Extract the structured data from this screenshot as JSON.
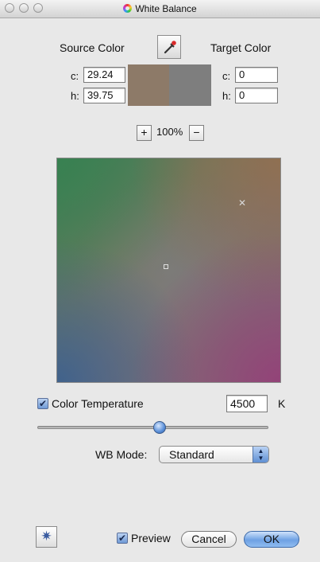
{
  "window": {
    "title": "White Balance"
  },
  "source": {
    "label": "Source Color",
    "c_label": "c:",
    "c_value": "29.24",
    "h_label": "h:",
    "h_value": "39.75",
    "swatch_color": "#8d7a68"
  },
  "target": {
    "label": "Target Color",
    "c_label": "c:",
    "c_value": "0",
    "h_label": "h:",
    "h_value": "0",
    "swatch_color": "#7e7e7e"
  },
  "zoom": {
    "plus": "+",
    "value": "100%",
    "minus": "−"
  },
  "color_temperature": {
    "label": "Color Temperature",
    "checked": true,
    "value": "4500",
    "unit": "K",
    "slider_fraction": 0.53
  },
  "wb_mode": {
    "label": "WB Mode:",
    "selected": "Standard"
  },
  "footer": {
    "preview_label": "Preview",
    "preview_checked": true,
    "cancel_label": "Cancel",
    "ok_label": "OK"
  },
  "icons": {
    "eyedropper": "eyedropper-icon",
    "gear": "gear-icon",
    "app": "color-wheel-icon"
  },
  "colors": {
    "accent_blue": "#6ea1e3",
    "window_bg": "#e8e8e8"
  }
}
